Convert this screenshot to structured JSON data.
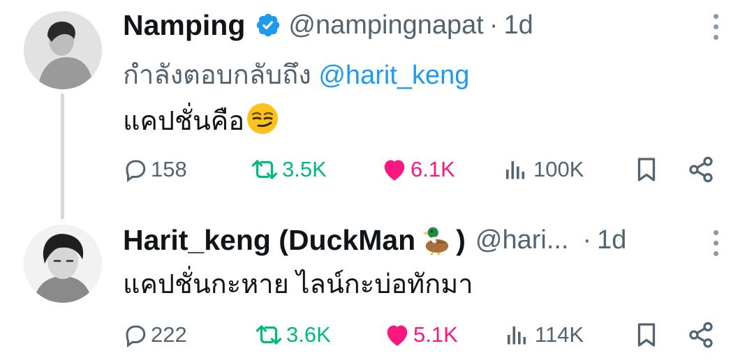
{
  "tweets": [
    {
      "name": "Namping",
      "handle": "@nampingnapat",
      "separator": "·",
      "time": "1d",
      "reply_prefix": "กำลังตอบกลับถึง",
      "reply_mention": "@harit_keng",
      "text": "แคปชั่นคือ",
      "text_emoji": "smirking-face-icon",
      "stats": {
        "replies": "158",
        "retweets": "3.5K",
        "likes": "6.1K",
        "views": "100K"
      }
    },
    {
      "name_start": "Harit_keng (DuckMan",
      "name_end": ")",
      "name_emoji": "duck-icon",
      "handle": "@hari...",
      "separator": "·",
      "time": "1d",
      "text": "แคปชั่นกะหาย ไลน์กะบ่อทักมา",
      "stats": {
        "replies": "222",
        "retweets": "3.6K",
        "likes": "5.1K",
        "views": "114K"
      }
    }
  ],
  "colors": {
    "verified": "#1d9bf0",
    "mention": "#1d9bf0",
    "retweet": "#00ba7c",
    "like": "#f91880",
    "secondary_text": "#536471"
  }
}
